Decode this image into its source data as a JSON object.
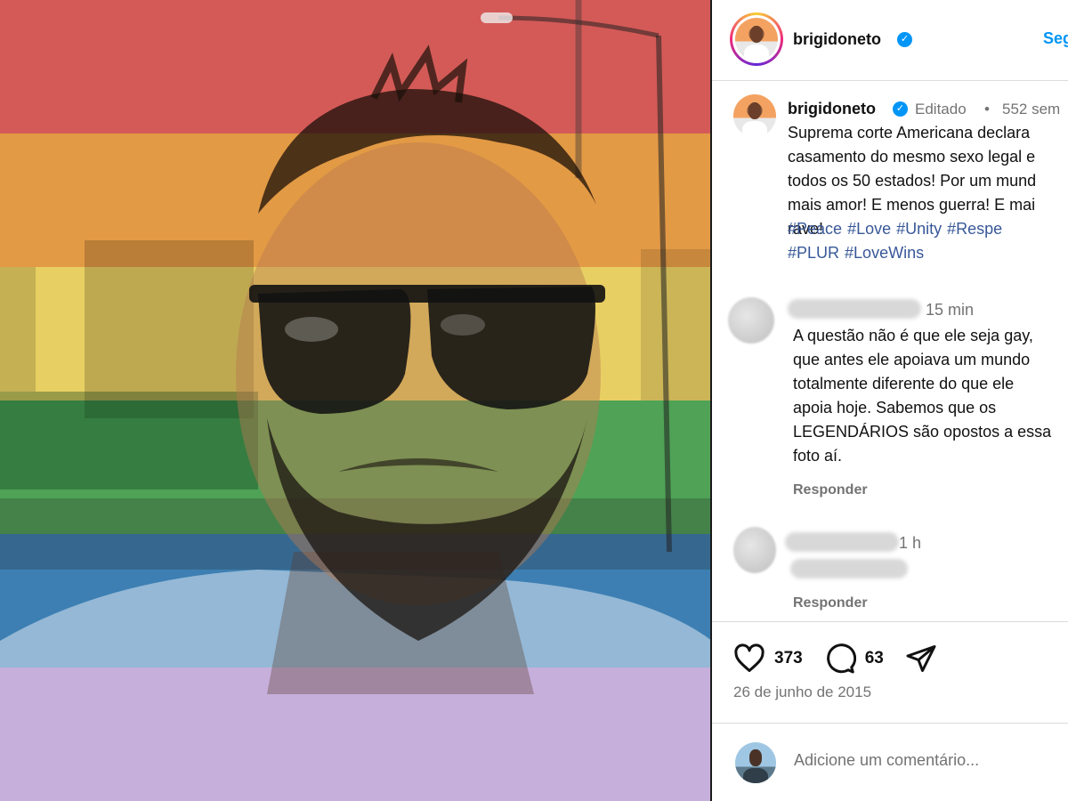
{
  "post": {
    "image": {
      "description_icon": "rainbow-filter-selfie-photo",
      "stripe_colors": [
        "#d45a57",
        "#e39a45",
        "#e8cf63",
        "#4fa256",
        "#3d7fb3",
        "#9a6dbf"
      ]
    },
    "header": {
      "username": "brigidoneto",
      "follow_label": "Segu"
    },
    "caption": {
      "username": "brigidoneto",
      "edited_label": "Editado",
      "separator": "•",
      "age": "552 sem",
      "text": "Suprema corte Americana declara\ncasamento do mesmo sexo legal e\ntodos os 50 estados! Por um mund\nmais amor! E menos guerra! E mai\nrave!",
      "hashtags_line1": [
        "#Peace",
        "#Love",
        "#Unity",
        "#Respe"
      ],
      "hashtags_line2": [
        "#PLUR",
        "#LoveWins"
      ]
    },
    "comments": [
      {
        "time": "15 min",
        "text": "A questão não é que ele seja gay,\nque antes ele apoiava um mundo\ntotalmente diferente do que ele\napoia hoje. Sabemos que os\nLEGENDÁRIOS são opostos a essa\nfoto aí.",
        "reply_label": "Responder"
      },
      {
        "time": "1 h",
        "text": "",
        "reply_label": "Responder"
      }
    ],
    "actions": {
      "likes": "373",
      "comments": "63"
    },
    "date": "26 de junho de 2015",
    "add_comment_placeholder": "Adicione um comentário..."
  },
  "colors": {
    "verified_blue": "#0095f6",
    "follow_blue": "#0095f6",
    "hashtag_blue": "#385898",
    "muted_gray": "#737373"
  }
}
